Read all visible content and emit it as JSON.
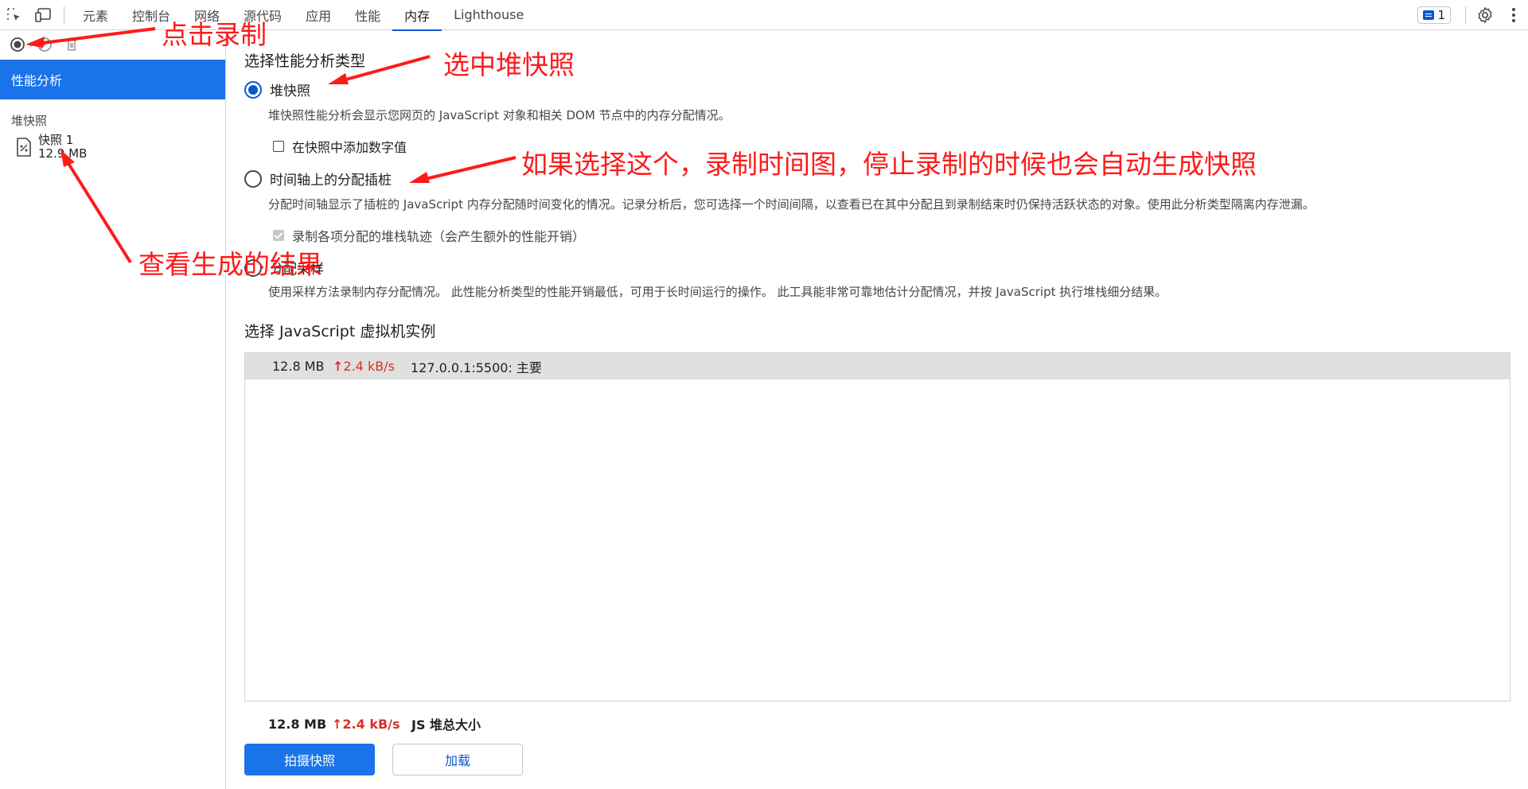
{
  "toolbar": {
    "inspect_icon": "inspect-element-icon",
    "device_icon": "device-toolbar-icon",
    "tabs": [
      {
        "label": "元素"
      },
      {
        "label": "控制台"
      },
      {
        "label": "网络"
      },
      {
        "label": "源代码"
      },
      {
        "label": "应用"
      },
      {
        "label": "性能"
      },
      {
        "label": "内存"
      },
      {
        "label": "Lighthouse"
      }
    ],
    "active_tab": "内存",
    "issues_count": "1"
  },
  "sidebar": {
    "header": "性能分析",
    "group_title": "堆快照",
    "snapshot": {
      "name": "快照 1",
      "size": "12.9 MB"
    }
  },
  "main": {
    "section_title": "选择性能分析类型",
    "options": [
      {
        "label": "堆快照",
        "checked": true,
        "description": "堆快照性能分析会显示您网页的 JavaScript 对象和相关 DOM 节点中的内存分配情况。"
      },
      {
        "label": "时间轴上的分配插桩",
        "checked": false,
        "description": "分配时间轴显示了插桩的 JavaScript 内存分配随时间变化的情况。记录分析后，您可选择一个时间间隔，以查看已在其中分配且到录制结束时仍保持活跃状态的对象。使用此分析类型隔离内存泄漏。"
      },
      {
        "label": "分配采样",
        "checked": false,
        "description": "使用采样方法录制内存分配情况。 此性能分析类型的性能开销最低，可用于长时间运行的操作。 此工具能非常可靠地估计分配情况，并按 JavaScript 执行堆栈细分结果。"
      }
    ],
    "heap_checkbox": "在快照中添加数字值",
    "timeline_checkbox": "录制各项分配的堆栈轨迹（会产生额外的性能开销）",
    "vm_section_title": "选择 JavaScript 虚拟机实例",
    "vm_row": {
      "size": "12.8 MB",
      "rate_arrow": "↑",
      "rate": "2.4 kB/s",
      "name": "127.0.0.1:5500: 主要"
    },
    "footer": {
      "size": "12.8 MB",
      "rate_arrow": "↑",
      "rate": "2.4 kB/s",
      "label": "JS 堆总大小"
    },
    "buttons": {
      "primary": "拍摄快照",
      "secondary": "加载"
    }
  },
  "annotations": {
    "click_record": "点击录制",
    "select_heap": "选中堆快照",
    "timeline_note": "如果选择这个，录制时间图，停止录制的时候也会自动生成快照",
    "view_result": "查看生成的结果",
    "color": "#ff1a1a"
  },
  "colors": {
    "accent": "#1a73e8",
    "rate_red": "#d93025"
  }
}
